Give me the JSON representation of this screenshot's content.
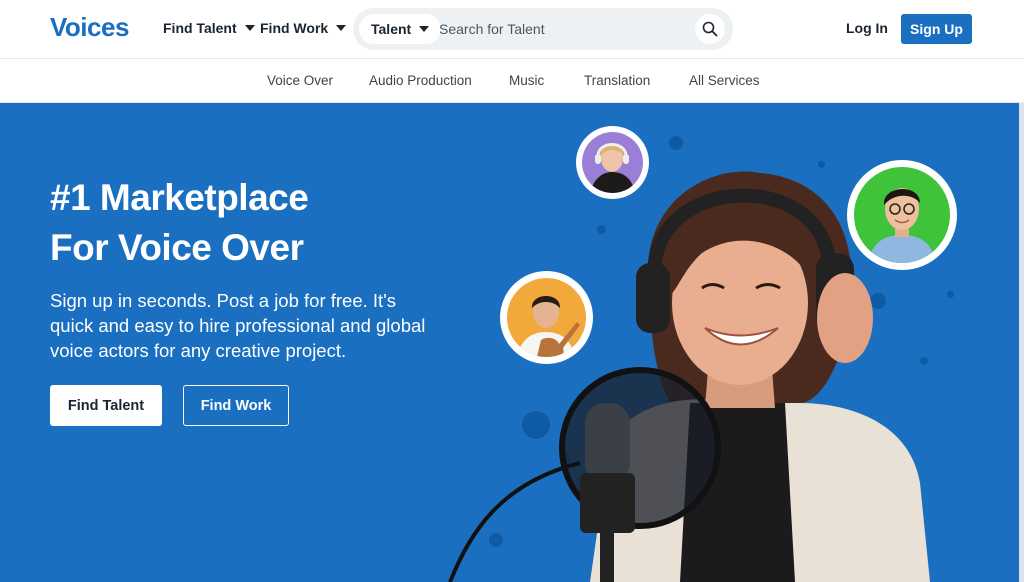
{
  "brand": {
    "logo": "Voices"
  },
  "nav": {
    "find_talent": "Find Talent",
    "find_work": "Find Work",
    "login": "Log In",
    "signup": "Sign Up"
  },
  "search": {
    "category": "Talent",
    "placeholder": "Search for Talent"
  },
  "services": {
    "items": [
      "Voice Over",
      "Audio Production",
      "Music",
      "Translation",
      "All Services"
    ]
  },
  "hero": {
    "title_line1": "#1 Marketplace",
    "title_line2": "For Voice Over",
    "subtitle": "Sign up in seconds. Post a job for free. It's quick and easy to hire professional and global voice actors for any creative project.",
    "cta_primary": "Find Talent",
    "cta_secondary": "Find Work"
  },
  "colors": {
    "brand_blue": "#1a6fc0",
    "dot_blue": "#0f5aa4",
    "avatar_purple": "#9b7fd6",
    "avatar_green": "#3fc33a",
    "avatar_orange": "#f2a93b"
  },
  "icons": {
    "search": "search-icon",
    "caret": "chevron-down-icon"
  }
}
